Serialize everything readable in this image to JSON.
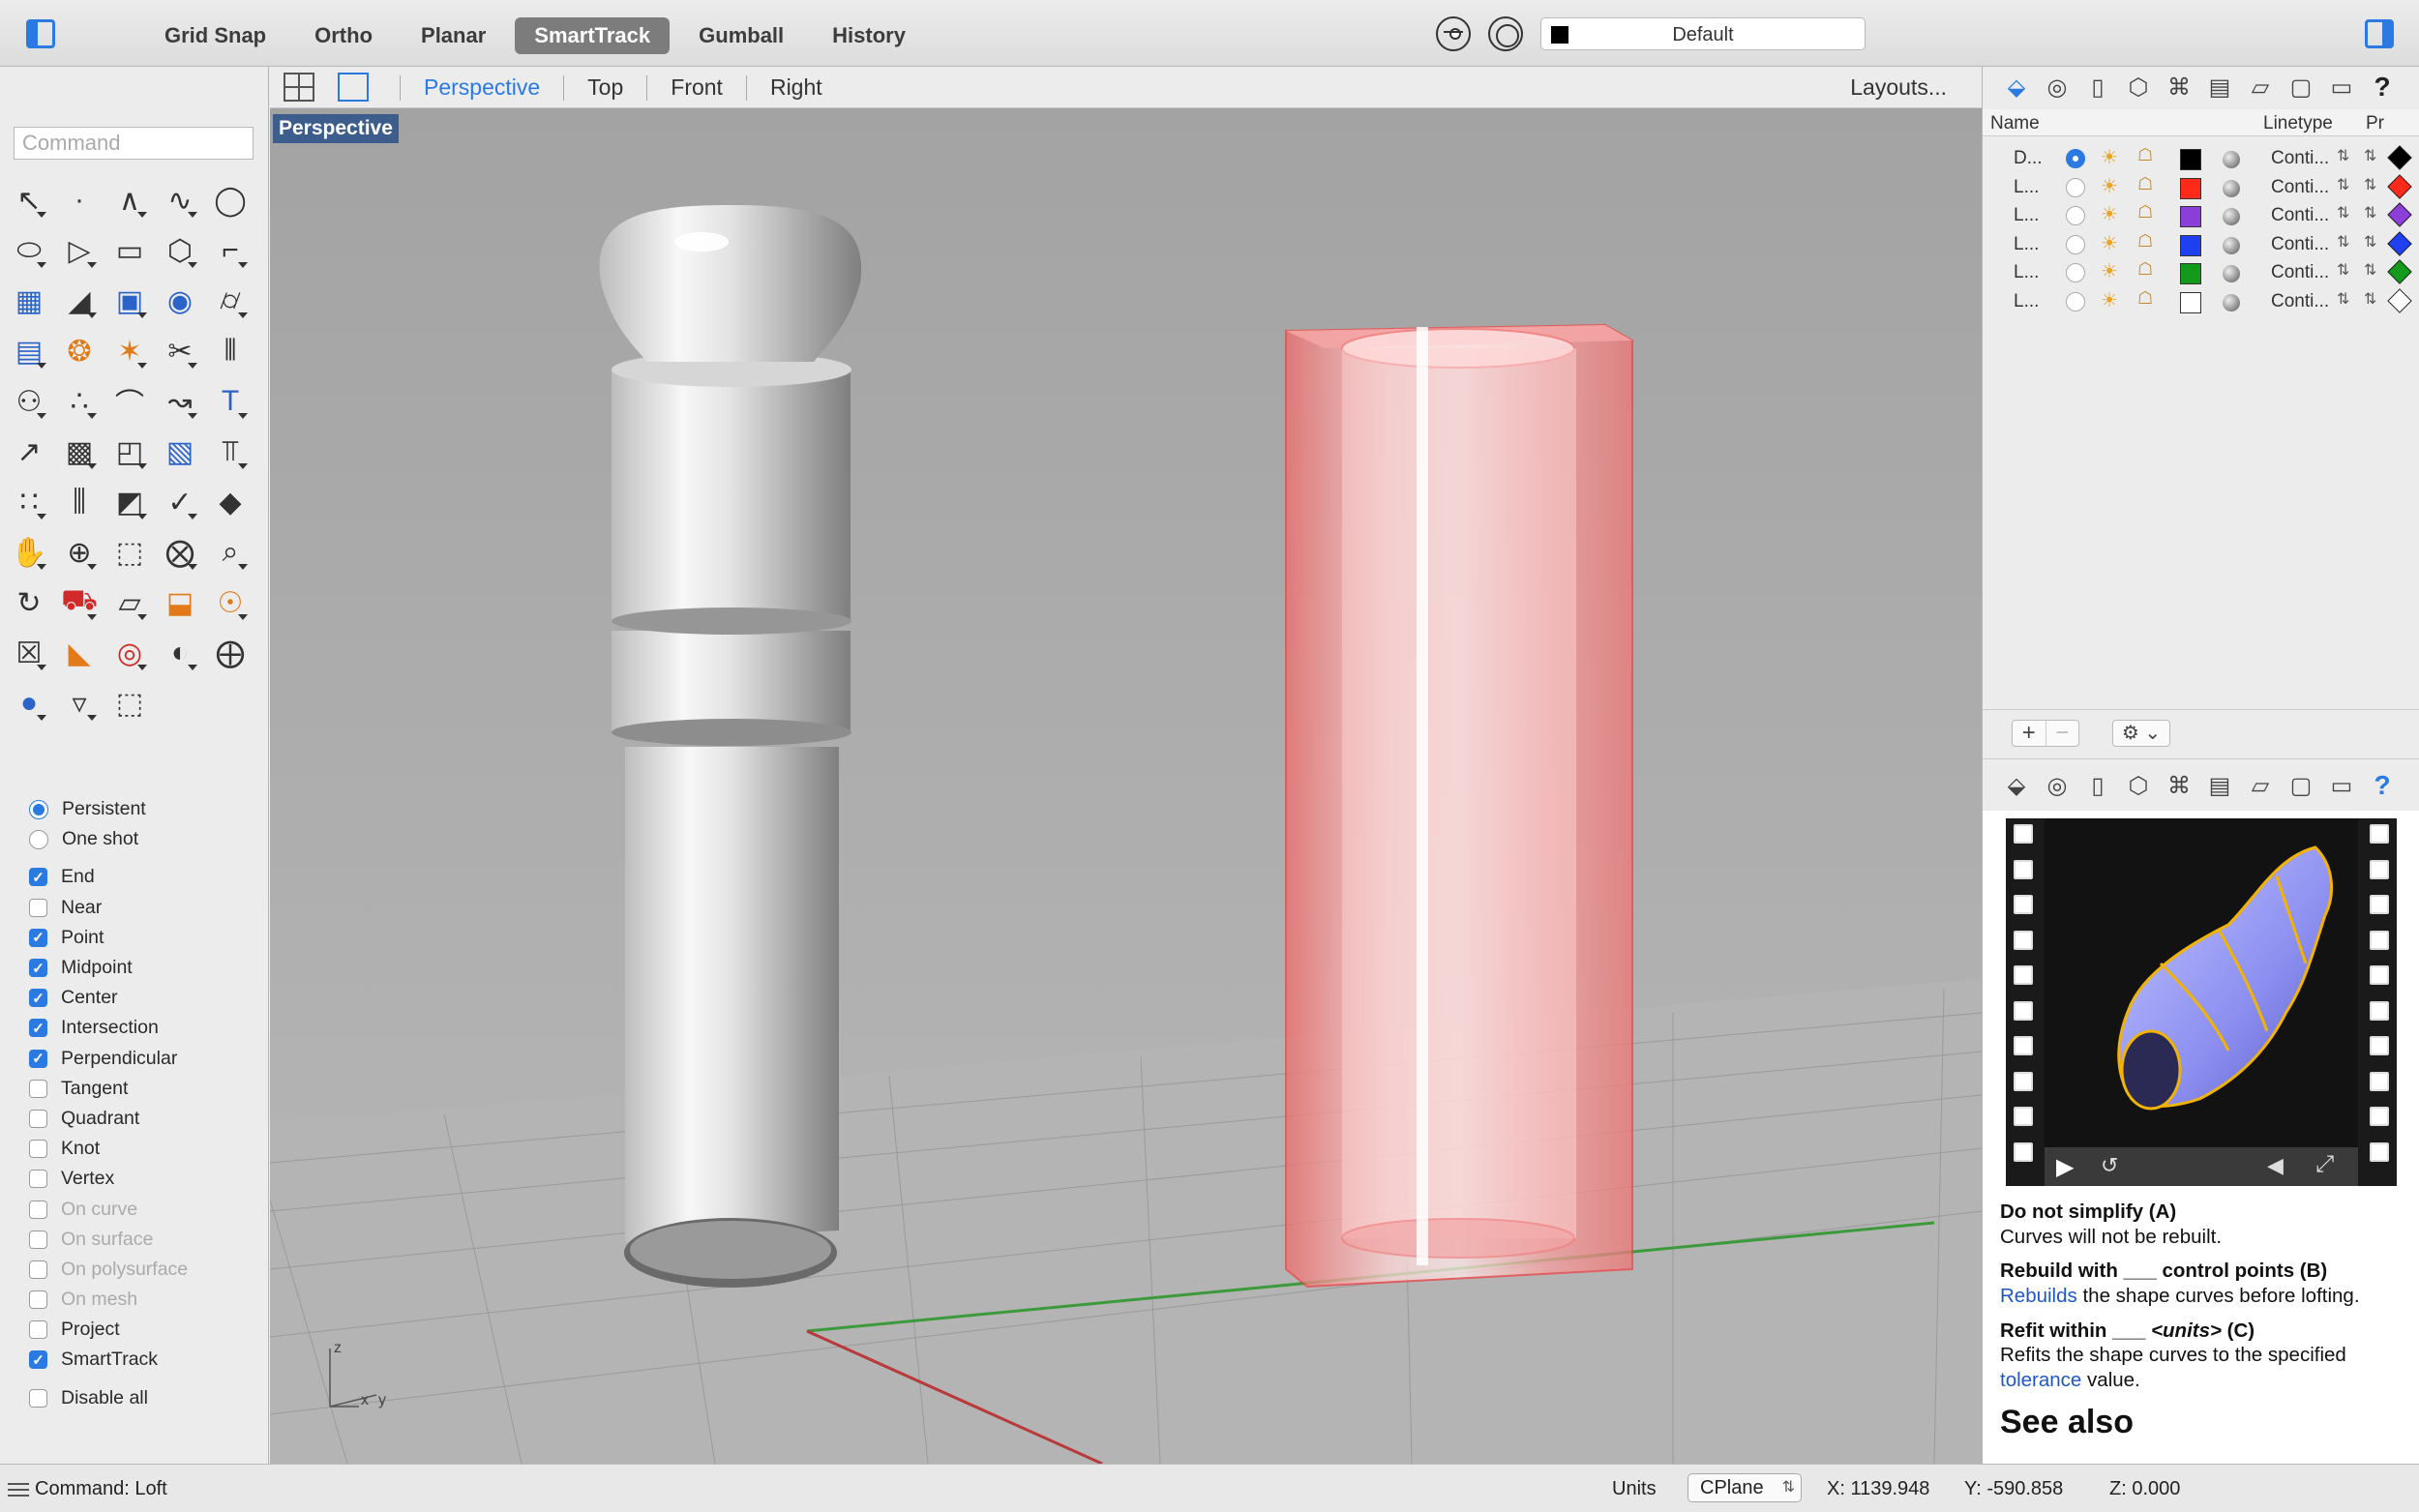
{
  "toolbar": {
    "modes": [
      {
        "label": "Grid Snap",
        "active": false
      },
      {
        "label": "Ortho",
        "active": false
      },
      {
        "label": "Planar",
        "active": false
      },
      {
        "label": "SmartTrack",
        "active": true
      },
      {
        "label": "Gumball",
        "active": false
      },
      {
        "label": "History",
        "active": false
      }
    ],
    "current_layer": "Default",
    "current_layer_color": "#000000"
  },
  "command": {
    "placeholder": "Command"
  },
  "tools": [
    {
      "icon": "select-arrow-icon",
      "glyph": "↖"
    },
    {
      "icon": "point-icon",
      "glyph": "·"
    },
    {
      "icon": "polyline-icon",
      "glyph": "∧"
    },
    {
      "icon": "curve-icon",
      "glyph": "∿"
    },
    {
      "icon": "circle-icon",
      "glyph": "◯"
    },
    {
      "icon": "ellipse-icon",
      "glyph": "⬭"
    },
    {
      "icon": "polygon-icon",
      "glyph": "▷"
    },
    {
      "icon": "rectangle-icon",
      "glyph": "▭"
    },
    {
      "icon": "hexagon-icon",
      "glyph": "⬡"
    },
    {
      "icon": "fillet-icon",
      "glyph": "⌐"
    },
    {
      "icon": "surface-icon",
      "glyph": "▦"
    },
    {
      "icon": "extrude-surface-icon",
      "glyph": "◢"
    },
    {
      "icon": "box-icon",
      "glyph": "▣"
    },
    {
      "icon": "sphere-icon",
      "glyph": "◉"
    },
    {
      "icon": "cylinder-icon",
      "glyph": "⌭"
    },
    {
      "icon": "mesh-icon",
      "glyph": "▤"
    },
    {
      "icon": "puzzle-icon",
      "glyph": "❂"
    },
    {
      "icon": "explode-icon",
      "glyph": "✶"
    },
    {
      "icon": "trim-icon",
      "glyph": "✂"
    },
    {
      "icon": "split-icon",
      "glyph": "⫴"
    },
    {
      "icon": "boolean-icon",
      "glyph": "⚇"
    },
    {
      "icon": "group-icon",
      "glyph": "∴"
    },
    {
      "icon": "arc-icon",
      "glyph": "⌒"
    },
    {
      "icon": "rebuild-curve-icon",
      "glyph": "↝"
    },
    {
      "icon": "text-icon",
      "glyph": "T"
    },
    {
      "icon": "move-icon",
      "glyph": "↗"
    },
    {
      "icon": "array-icon",
      "glyph": "▩"
    },
    {
      "icon": "scale-icon",
      "glyph": "◰"
    },
    {
      "icon": "solid-edit-icon",
      "glyph": "▧"
    },
    {
      "icon": "dimension-icon",
      "glyph": "⫪"
    },
    {
      "icon": "grid-array-icon",
      "glyph": "∷"
    },
    {
      "icon": "align-icon",
      "glyph": "⫼"
    },
    {
      "icon": "analyze-icon",
      "glyph": "◩"
    },
    {
      "icon": "check-icon",
      "glyph": "✓"
    },
    {
      "icon": "surface-analysis-icon",
      "glyph": "◆"
    },
    {
      "icon": "view-pan-icon",
      "glyph": "✋"
    },
    {
      "icon": "zoom-icon",
      "glyph": "⊕"
    },
    {
      "icon": "zoom-window-icon",
      "glyph": "⬚"
    },
    {
      "icon": "zoom-extents-icon",
      "glyph": "⨂"
    },
    {
      "icon": "zoom-selected-icon",
      "glyph": "⌕"
    },
    {
      "icon": "rotate-view-icon",
      "glyph": "↻"
    },
    {
      "icon": "car-icon",
      "glyph": "⛟"
    },
    {
      "icon": "plane-icon",
      "glyph": "▱"
    },
    {
      "icon": "cplane-icon",
      "glyph": "⬓"
    },
    {
      "icon": "light-icon",
      "glyph": "☉"
    },
    {
      "icon": "lock-icon",
      "glyph": "☒"
    },
    {
      "icon": "material-icon",
      "glyph": "◣"
    },
    {
      "icon": "color-wheel-icon",
      "glyph": "◎"
    },
    {
      "icon": "shaded-sphere-icon",
      "glyph": "◐"
    },
    {
      "icon": "wire-sphere-icon",
      "glyph": "⨁"
    },
    {
      "icon": "render-sphere-icon",
      "glyph": "●"
    },
    {
      "icon": "cone-light-icon",
      "glyph": "▿"
    },
    {
      "icon": "gumball-icon",
      "glyph": "⬚"
    }
  ],
  "osnap": {
    "modes": [
      {
        "label": "Persistent",
        "type": "radio",
        "checked": true,
        "disabled": false
      },
      {
        "label": "One shot",
        "type": "radio",
        "checked": false,
        "disabled": false
      }
    ],
    "snaps": [
      {
        "label": "End",
        "checked": true,
        "disabled": false
      },
      {
        "label": "Near",
        "checked": false,
        "disabled": false
      },
      {
        "label": "Point",
        "checked": true,
        "disabled": false
      },
      {
        "label": "Midpoint",
        "checked": true,
        "disabled": false
      },
      {
        "label": "Center",
        "checked": true,
        "disabled": false
      },
      {
        "label": "Intersection",
        "checked": true,
        "disabled": false
      },
      {
        "label": "Perpendicular",
        "checked": true,
        "disabled": false
      },
      {
        "label": "Tangent",
        "checked": false,
        "disabled": false
      },
      {
        "label": "Quadrant",
        "checked": false,
        "disabled": false
      },
      {
        "label": "Knot",
        "checked": false,
        "disabled": false
      },
      {
        "label": "Vertex",
        "checked": false,
        "disabled": false
      },
      {
        "label": "On curve",
        "checked": false,
        "disabled": true
      },
      {
        "label": "On surface",
        "checked": false,
        "disabled": true
      },
      {
        "label": "On polysurface",
        "checked": false,
        "disabled": true
      },
      {
        "label": "On mesh",
        "checked": false,
        "disabled": true
      },
      {
        "label": "Project",
        "checked": false,
        "disabled": false
      },
      {
        "label": "SmartTrack",
        "checked": true,
        "disabled": false
      }
    ],
    "disable_all": {
      "label": "Disable all",
      "checked": false
    }
  },
  "viewport_tabs": [
    "Perspective",
    "Top",
    "Front",
    "Right"
  ],
  "active_viewport_tab": "Perspective",
  "layouts_label": "Layouts...",
  "viewport": {
    "title": "Perspective",
    "axis_labels": {
      "z": "z",
      "x": "x",
      "y": "y"
    }
  },
  "layers_panel": {
    "columns": {
      "name": "Name",
      "linetype": "Linetype",
      "print": "Pr"
    },
    "rows": [
      {
        "name": "D...",
        "current": true,
        "color": "#000000",
        "linetype": "Conti...",
        "print_color": "#000000"
      },
      {
        "name": "L...",
        "current": false,
        "color": "#ff2a1a",
        "linetype": "Conti...",
        "print_color": "#ff2a1a"
      },
      {
        "name": "L...",
        "current": false,
        "color": "#8c3fd8",
        "linetype": "Conti...",
        "print_color": "#8c3fd8"
      },
      {
        "name": "L...",
        "current": false,
        "color": "#1f3ff0",
        "linetype": "Conti...",
        "print_color": "#1f3ff0"
      },
      {
        "name": "L...",
        "current": false,
        "color": "#139a1a",
        "linetype": "Conti...",
        "print_color": "#139a1a"
      },
      {
        "name": "L...",
        "current": false,
        "color": "#ffffff",
        "linetype": "Conti...",
        "print_color": "#ffffff"
      }
    ],
    "add": "+",
    "remove": "−",
    "gear": "⚙ ⌄"
  },
  "panel_tabs": [
    "layers-icon",
    "materials-icon",
    "properties-icon",
    "object-icon",
    "camera-icon",
    "grid-icon",
    "display-icon",
    "viewports-icon",
    "monitor-icon",
    "help-icon"
  ],
  "help": {
    "items": [
      {
        "title": "Do not simplify (A)",
        "body": [
          "Curves will not be rebuilt."
        ]
      },
      {
        "title": "Rebuild with ___ control points (B)",
        "link": "Rebuilds",
        "body": [
          " the shape curves before lofting."
        ]
      },
      {
        "title_pre": "Refit within ___ ",
        "title_em": "<units>",
        "title_post": " (C)",
        "body_pre": "Refits the shape curves to the specified ",
        "link": "tolerance",
        "body_post": " value."
      }
    ],
    "see_also": "See also"
  },
  "status": {
    "command": "Command: Loft",
    "units_label": "Units",
    "cplane": "CPlane",
    "x": "X: 1139.948",
    "y": "Y: -590.858",
    "z": "Z: 0.000"
  }
}
